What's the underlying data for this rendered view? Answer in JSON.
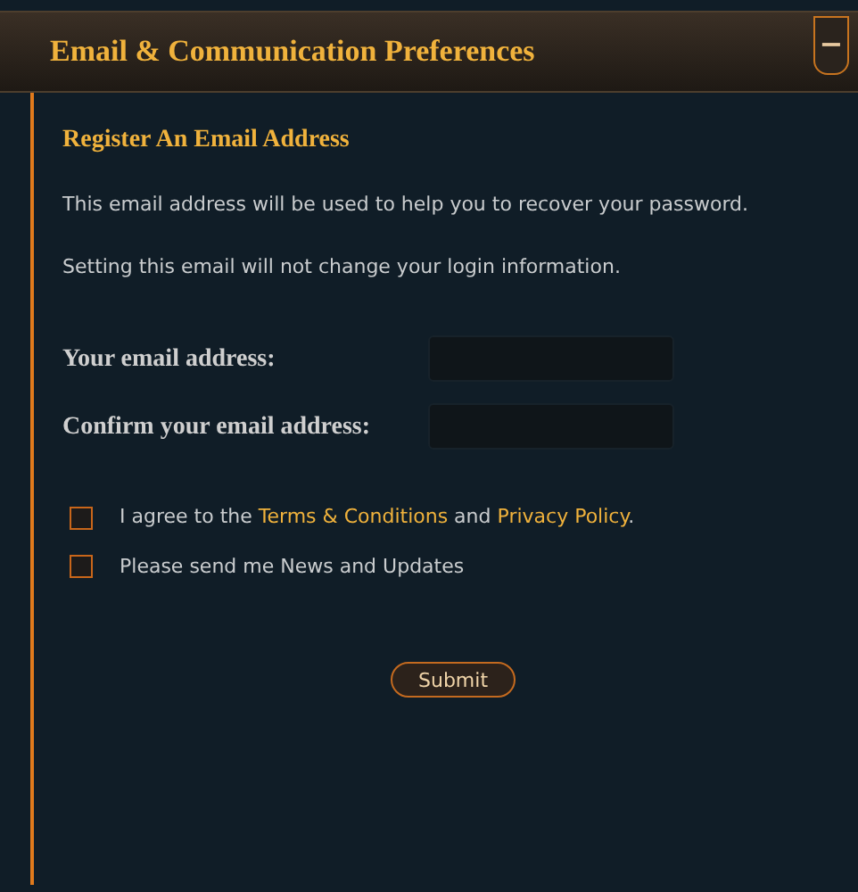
{
  "panel": {
    "title": "Email & Communication Preferences",
    "collapse_button": "−"
  },
  "section": {
    "heading": "Register An Email Address",
    "paragraphs": [
      "This email address will be used to help you to recover your password.",
      "Setting this email will not change your login information."
    ]
  },
  "fields": [
    {
      "label": "Your email address:"
    },
    {
      "label": "Confirm your email address:"
    }
  ],
  "checkboxes": [
    {
      "checked": false,
      "parts": [
        {
          "kind": "text",
          "text": "I agree to the "
        },
        {
          "kind": "link",
          "text": "Terms & Conditions"
        },
        {
          "kind": "text",
          "text": " and "
        },
        {
          "kind": "link",
          "text": "Privacy Policy"
        },
        {
          "kind": "text",
          "text": "."
        }
      ]
    },
    {
      "checked": false,
      "parts": [
        {
          "kind": "text",
          "text": "Please send me News and Updates"
        }
      ]
    }
  ],
  "submit_button": "Submit"
}
